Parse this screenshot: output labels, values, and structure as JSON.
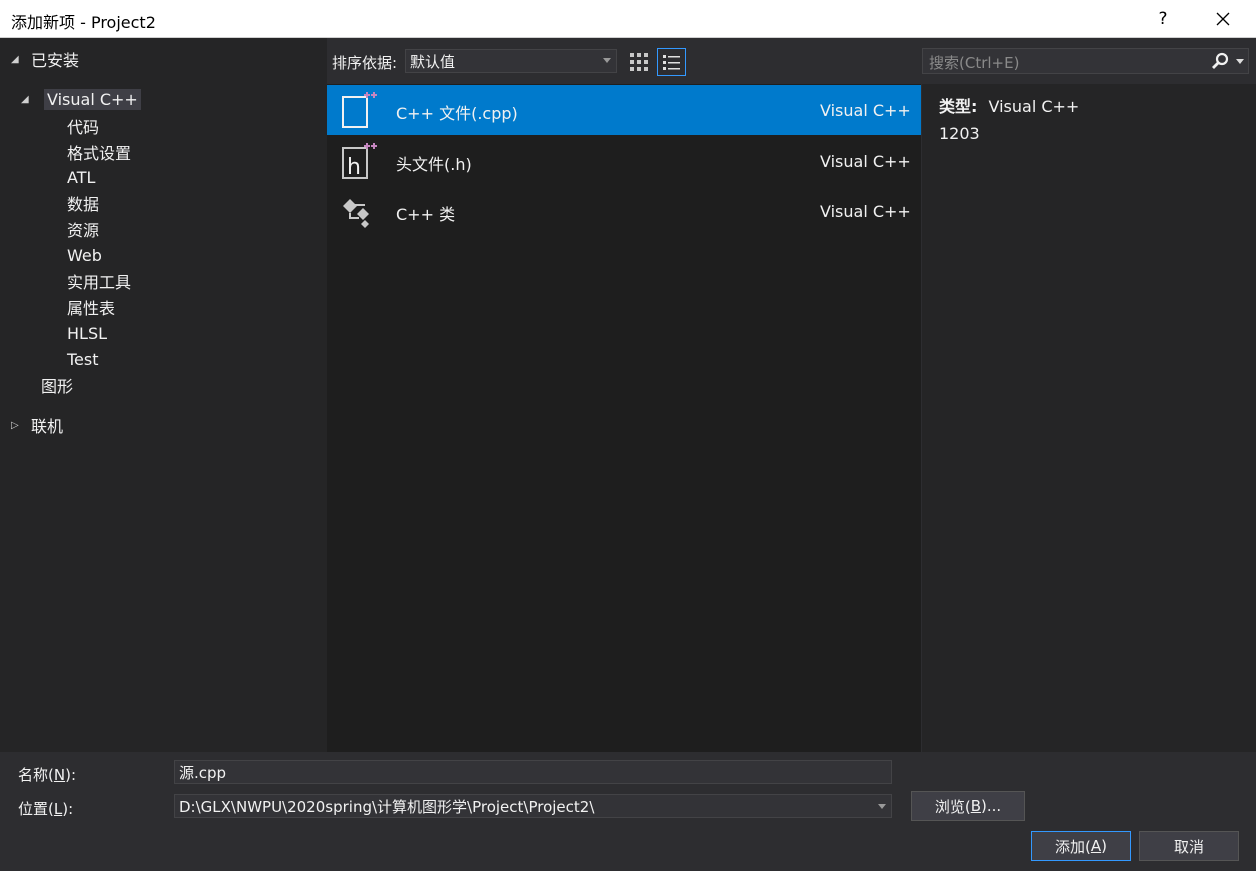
{
  "window": {
    "title": "添加新项 - Project2",
    "help": "?",
    "close_icon": "close-icon"
  },
  "tree": {
    "installed": "已安装",
    "visual_cpp": "Visual C++",
    "children": [
      "代码",
      "格式设置",
      "ATL",
      "数据",
      "资源",
      "Web",
      "实用工具",
      "属性表",
      "HLSL",
      "Test"
    ],
    "graphics": "图形",
    "online": "联机"
  },
  "toolbar": {
    "sort_label": "排序依据:",
    "sort_value": "默认值"
  },
  "items": [
    {
      "name": "C++ 文件(.cpp)",
      "lang": "Visual C++",
      "icon": "cpp-file-icon"
    },
    {
      "name": "头文件(.h)",
      "lang": "Visual C++",
      "icon": "header-file-icon"
    },
    {
      "name": "C++ 类",
      "lang": "Visual C++",
      "icon": "cpp-class-icon"
    }
  ],
  "search": {
    "placeholder": "搜索(Ctrl+E)"
  },
  "info": {
    "type_label": "类型:",
    "type_value": "Visual C++",
    "description": "1203"
  },
  "form": {
    "name_label_pre": "名称(",
    "name_label_key": "N",
    "name_label_post": "):",
    "name_value": "源.cpp",
    "location_label_pre": "位置(",
    "location_label_key": "L",
    "location_label_post": "):",
    "location_value": "D:\\GLX\\NWPU\\2020spring\\计算机图形学\\Project\\Project2\\",
    "browse_pre": "浏览(",
    "browse_key": "B",
    "browse_post": ")...",
    "add_pre": "添加(",
    "add_key": "A",
    "add_post": ")",
    "cancel": "取消"
  },
  "colors": {
    "selection": "#007acc",
    "accent_border": "#3399ff",
    "background": "#2d2d30"
  }
}
